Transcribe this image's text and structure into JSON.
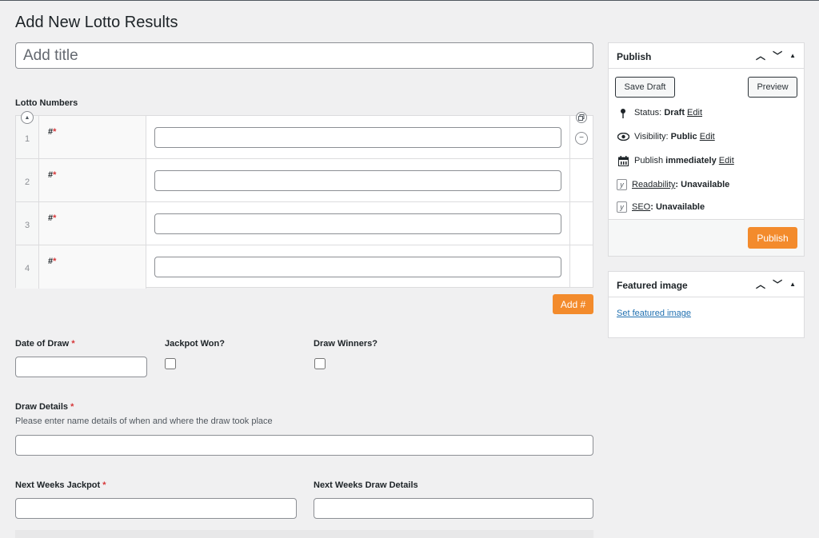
{
  "page": {
    "title": "Add New Lotto Results"
  },
  "title_field": {
    "placeholder": "Add title"
  },
  "lotto_numbers": {
    "label": "Lotto Numbers",
    "field_label": "#",
    "required_mark": "*",
    "rows": [
      {
        "index": "1"
      },
      {
        "index": "2"
      },
      {
        "index": "3"
      },
      {
        "index": "4"
      }
    ],
    "add_button": "Add #"
  },
  "fields": {
    "date_of_draw": {
      "label": "Date of Draw",
      "required_mark": "*"
    },
    "jackpot_won": {
      "label": "Jackpot Won?"
    },
    "draw_winners": {
      "label": "Draw Winners?"
    },
    "draw_details": {
      "label": "Draw Details",
      "required_mark": "*",
      "help": "Please enter name details of when and where the draw took place"
    },
    "next_weeks_jackpot": {
      "label": "Next Weeks Jackpot",
      "required_mark": "*"
    },
    "next_weeks_draw_details": {
      "label": "Next Weeks Draw Details"
    }
  },
  "publish_box": {
    "title": "Publish",
    "save_draft": "Save Draft",
    "preview": "Preview",
    "status_label": "Status:",
    "status_value": "Draft",
    "visibility_label": "Visibility:",
    "visibility_value": "Public",
    "publish_label": "Publish",
    "publish_value": "immediately",
    "edit": "Edit",
    "readability_label": "Readability",
    "readability_value": ": Unavailable",
    "seo_label": "SEO",
    "seo_value": ": Unavailable",
    "publish_button": "Publish"
  },
  "featured_box": {
    "title": "Featured image",
    "link": "Set featured image"
  },
  "colors": {
    "accent": "#f38b2c",
    "required": "#d63638",
    "border": "#dcdcde",
    "background": "#f0f0f1"
  }
}
